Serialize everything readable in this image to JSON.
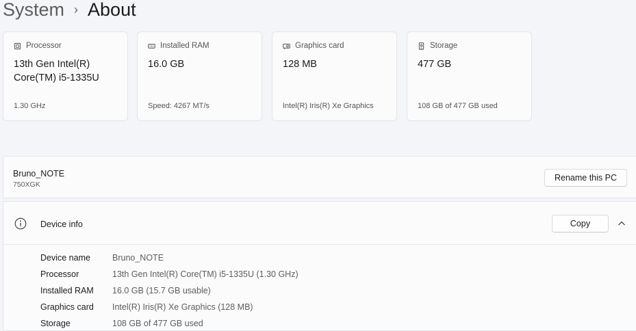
{
  "breadcrumb": {
    "parent": "System",
    "separator": "›",
    "current": "About"
  },
  "cards": [
    {
      "icon": "processor-icon",
      "label": "Processor",
      "value": "13th Gen Intel(R) Core(TM) i5-1335U",
      "sub": "1.30 GHz"
    },
    {
      "icon": "ram-icon",
      "label": "Installed RAM",
      "value": "16.0 GB",
      "sub": "Speed: 4267 MT/s"
    },
    {
      "icon": "graphics-card-icon",
      "label": "Graphics card",
      "value": "128 MB",
      "sub": "Intel(R) Iris(R) Xe Graphics"
    },
    {
      "icon": "storage-icon",
      "label": "Storage",
      "value": "477 GB",
      "sub": "108 GB of 477 GB used"
    }
  ],
  "pc": {
    "name": "Bruno_NOTE",
    "model": "750XGK",
    "rename_label": "Rename this PC"
  },
  "device_info": {
    "title": "Device info",
    "icon": "info-icon",
    "copy_label": "Copy",
    "rows": [
      {
        "label": "Device name",
        "value": "Bruno_NOTE"
      },
      {
        "label": "Processor",
        "value": "13th Gen Intel(R) Core(TM) i5-1335U (1.30 GHz)"
      },
      {
        "label": "Installed RAM",
        "value": "16.0 GB (15.7 GB usable)"
      },
      {
        "label": "Graphics card",
        "value": "Intel(R) Iris(R) Xe Graphics (128 MB)"
      },
      {
        "label": "Storage",
        "value": "108 GB of 477 GB used"
      }
    ]
  }
}
